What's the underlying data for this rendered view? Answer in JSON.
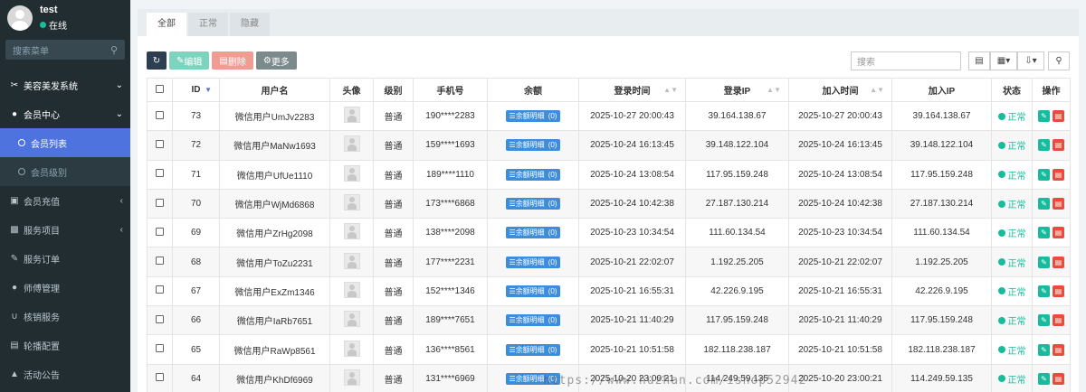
{
  "user": {
    "name": "test",
    "status": "在线"
  },
  "sidebar": {
    "search_placeholder": "搜索菜单",
    "items": [
      {
        "label": "美容美发系统",
        "icon": "scissors-icon"
      },
      {
        "label": "会员中心",
        "icon": "user-plus-icon"
      },
      {
        "label": "会员列表",
        "icon": "circle-icon"
      },
      {
        "label": "会员级别",
        "icon": "circle-icon"
      },
      {
        "label": "会员充值",
        "icon": "credit-card-icon"
      },
      {
        "label": "服务项目",
        "icon": "briefcase-icon"
      },
      {
        "label": "服务订单",
        "icon": "edit-square-icon"
      },
      {
        "label": "师傅管理",
        "icon": "users-icon"
      },
      {
        "label": "核销服务",
        "icon": "magnet-icon"
      },
      {
        "label": "轮播配置",
        "icon": "list-box-icon"
      },
      {
        "label": "活动公告",
        "icon": "bell-icon"
      }
    ]
  },
  "tabs": [
    "全部",
    "正常",
    "隐藏"
  ],
  "toolbar": {
    "edit_label": "编辑",
    "delete_label": "删除",
    "more_label": "更多",
    "search_placeholder": "搜索"
  },
  "table": {
    "headers": [
      "ID",
      "用户名",
      "头像",
      "级别",
      "手机号",
      "余额",
      "登录时间",
      "登录IP",
      "加入时间",
      "加入IP",
      "状态",
      "操作"
    ],
    "balance_button": "余额明细",
    "rows": [
      {
        "id": "73",
        "username": "微信用户UmJv2283",
        "level": "普通",
        "phone": "190****2283",
        "balance": "(0)",
        "login_time": "2025-10-27 20:00:43",
        "login_ip": "39.164.138.67",
        "join_time": "2025-10-27 20:00:43",
        "join_ip": "39.164.138.67",
        "status": "正常"
      },
      {
        "id": "72",
        "username": "微信用户MaNw1693",
        "level": "普通",
        "phone": "159****1693",
        "balance": "(0)",
        "login_time": "2025-10-24 16:13:45",
        "login_ip": "39.148.122.104",
        "join_time": "2025-10-24 16:13:45",
        "join_ip": "39.148.122.104",
        "status": "正常"
      },
      {
        "id": "71",
        "username": "微信用户UfUe1110",
        "level": "普通",
        "phone": "189****1110",
        "balance": "(0)",
        "login_time": "2025-10-24 13:08:54",
        "login_ip": "117.95.159.248",
        "join_time": "2025-10-24 13:08:54",
        "join_ip": "117.95.159.248",
        "status": "正常"
      },
      {
        "id": "70",
        "username": "微信用户WjMd6868",
        "level": "普通",
        "phone": "173****6868",
        "balance": "(0)",
        "login_time": "2025-10-24 10:42:38",
        "login_ip": "27.187.130.214",
        "join_time": "2025-10-24 10:42:38",
        "join_ip": "27.187.130.214",
        "status": "正常"
      },
      {
        "id": "69",
        "username": "微信用户ZrHg2098",
        "level": "普通",
        "phone": "138****2098",
        "balance": "(0)",
        "login_time": "2025-10-23 10:34:54",
        "login_ip": "111.60.134.54",
        "join_time": "2025-10-23 10:34:54",
        "join_ip": "111.60.134.54",
        "status": "正常"
      },
      {
        "id": "68",
        "username": "微信用户ToZu2231",
        "level": "普通",
        "phone": "177****2231",
        "balance": "(0)",
        "login_time": "2025-10-21 22:02:07",
        "login_ip": "1.192.25.205",
        "join_time": "2025-10-21 22:02:07",
        "join_ip": "1.192.25.205",
        "status": "正常"
      },
      {
        "id": "67",
        "username": "微信用户ExZm1346",
        "level": "普通",
        "phone": "152****1346",
        "balance": "(0)",
        "login_time": "2025-10-21 16:55:31",
        "login_ip": "42.226.9.195",
        "join_time": "2025-10-21 16:55:31",
        "join_ip": "42.226.9.195",
        "status": "正常"
      },
      {
        "id": "66",
        "username": "微信用户IaRb7651",
        "level": "普通",
        "phone": "189****7651",
        "balance": "(0)",
        "login_time": "2025-10-21 11:40:29",
        "login_ip": "117.95.159.248",
        "join_time": "2025-10-21 11:40:29",
        "join_ip": "117.95.159.248",
        "status": "正常"
      },
      {
        "id": "65",
        "username": "微信用户RaWp8561",
        "level": "普通",
        "phone": "136****8561",
        "balance": "(0)",
        "login_time": "2025-10-21 10:51:58",
        "login_ip": "182.118.238.187",
        "join_time": "2025-10-21 10:51:58",
        "join_ip": "182.118.238.187",
        "status": "正常"
      },
      {
        "id": "64",
        "username": "微信用户KhDf6969",
        "level": "普通",
        "phone": "131****6969",
        "balance": "(0)",
        "login_time": "2025-10-20 23:00:21",
        "login_ip": "114.249.59.135",
        "join_time": "2025-10-20 23:00:21",
        "join_ip": "114.249.59.135",
        "status": "正常"
      }
    ]
  },
  "watermark": "https://www.huzhan.com/ishop52942"
}
